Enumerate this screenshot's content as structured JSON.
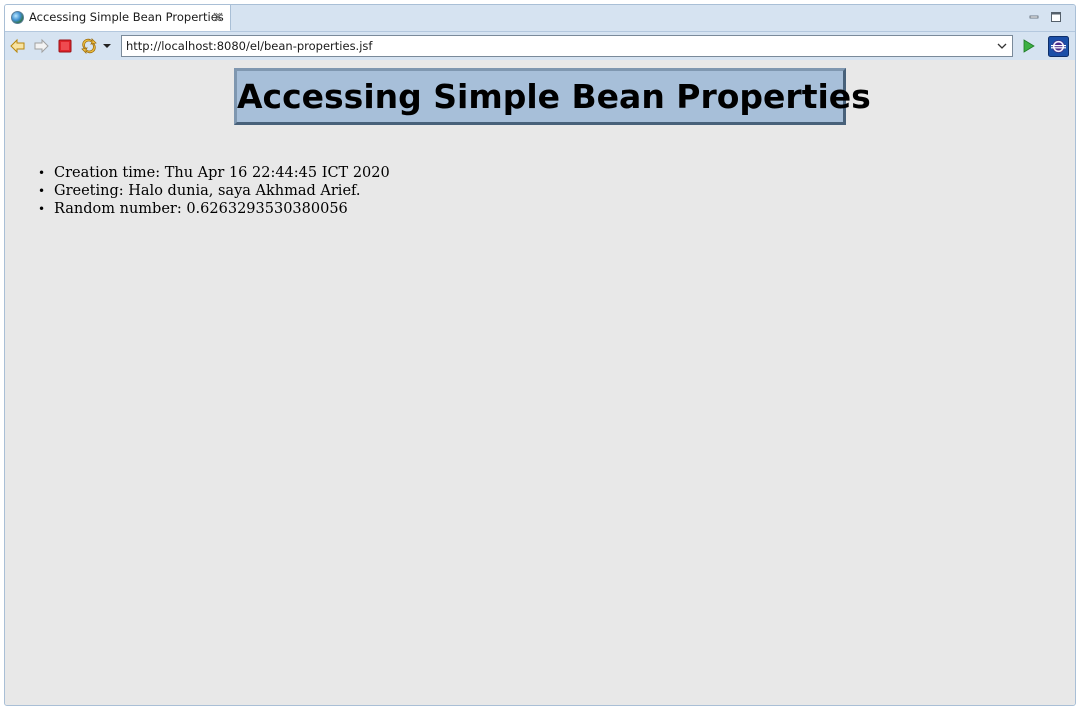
{
  "tab": {
    "title": "Accessing Simple Bean Properties",
    "icon": "globe-icon"
  },
  "toolbar": {
    "back_icon": "back-arrow-icon",
    "forward_icon": "forward-arrow-icon",
    "stop_icon": "stop-icon",
    "refresh_icon": "refresh-icon",
    "dropdown_icon": "chevron-down-icon",
    "go_icon": "go-play-icon",
    "browser_icon": "eclipse-browser-icon"
  },
  "address_bar": {
    "url": "http://localhost:8080/el/bean-properties.jsf"
  },
  "page": {
    "heading": "Accessing Simple Bean Properties",
    "items": [
      {
        "label": "Creation time:",
        "value": "Thu Apr 16 22:44:45 ICT 2020"
      },
      {
        "label": "Greeting:",
        "value": "Halo dunia, saya Akhmad Arief."
      },
      {
        "label": "Random number:",
        "value": "0.6263293530380056"
      }
    ]
  },
  "colors": {
    "chrome_bg": "#d6e3f1",
    "content_bg": "#e8e8e8",
    "heading_bg": "#a7bfd9",
    "heading_border": "#5f7a94"
  }
}
